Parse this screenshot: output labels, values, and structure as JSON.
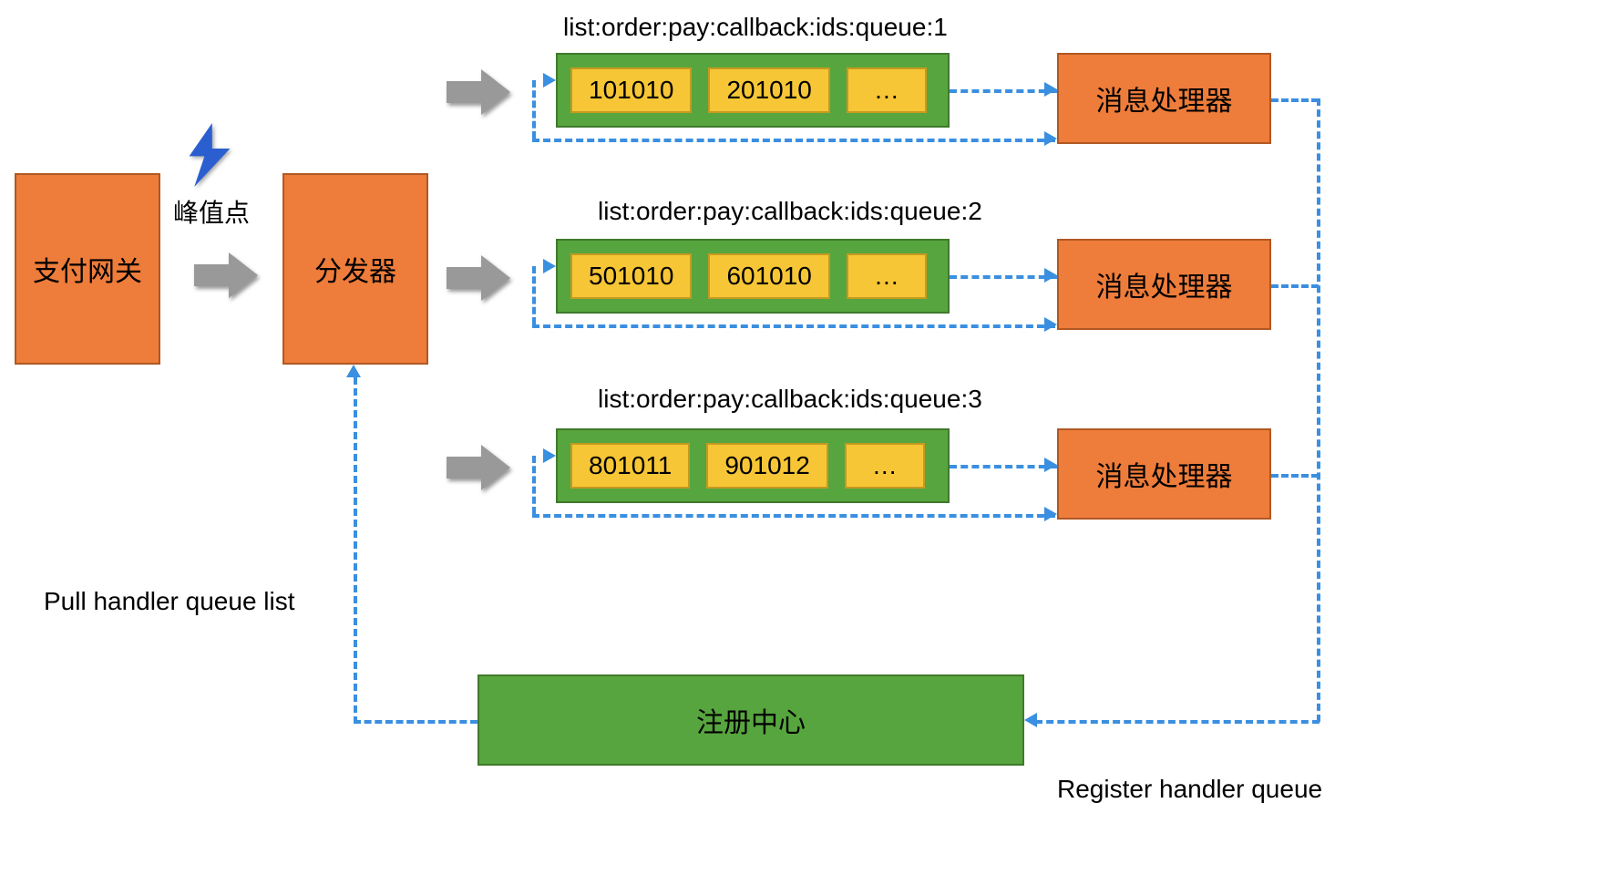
{
  "colors": {
    "orange": "#ee7c3a",
    "green": "#57a53e",
    "yellow": "#f7c636",
    "arrow_gray": "#999999",
    "dash_blue": "#3a8fe0",
    "bolt_blue": "#2b5fd0"
  },
  "nodes": {
    "gateway": "支付网关",
    "dispatcher": "分发器",
    "handler": "消息处理器",
    "registry": "注册中心",
    "peak_point": "峰值点"
  },
  "queues": [
    {
      "label": "list:order:pay:callback:ids:queue:1",
      "items": [
        "101010",
        "201010",
        "…"
      ]
    },
    {
      "label": "list:order:pay:callback:ids:queue:2",
      "items": [
        "501010",
        "601010",
        "…"
      ]
    },
    {
      "label": "list:order:pay:callback:ids:queue:3",
      "items": [
        "801011",
        "901012",
        "…"
      ]
    }
  ],
  "captions": {
    "pull": "Pull handler queue list",
    "register": "Register handler queue"
  }
}
